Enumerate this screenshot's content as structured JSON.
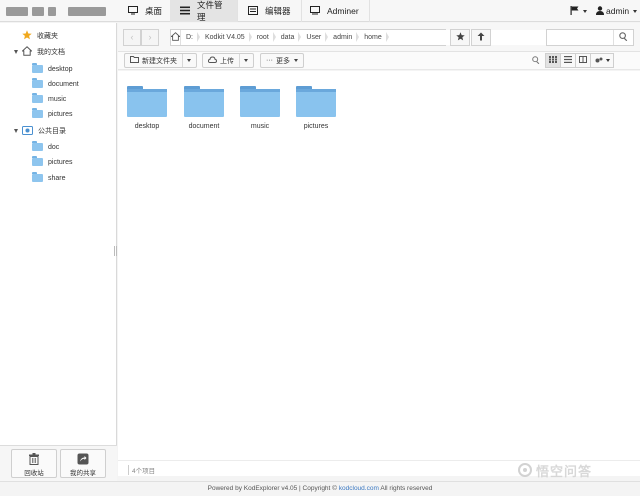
{
  "topbar": {
    "nav": [
      {
        "label": "桌面",
        "icon": "desktop-icon"
      },
      {
        "label": "文件管理",
        "icon": "list-icon",
        "active": true
      },
      {
        "label": "编辑器",
        "icon": "editor-icon"
      },
      {
        "label": "Adminer",
        "icon": "monitor-icon"
      }
    ],
    "user": "admin"
  },
  "sidebar": {
    "favorites_label": "收藏夹",
    "my_docs_label": "我的文档",
    "my_docs_children": [
      "desktop",
      "document",
      "music",
      "pictures"
    ],
    "public_label": "公共目录",
    "public_children": [
      "doc",
      "pictures",
      "share"
    ],
    "recycle_label": "回收站",
    "share_label": "我的共享"
  },
  "pathbar": {
    "crumbs": [
      "D:",
      "Kodkit V4.05",
      "root",
      "data",
      "User",
      "admin",
      "home"
    ]
  },
  "toolbar": {
    "new_folder_label": "新建文件夹",
    "upload_label": "上传",
    "more_label": "更多"
  },
  "files": [
    {
      "name": "desktop"
    },
    {
      "name": "document"
    },
    {
      "name": "music"
    },
    {
      "name": "pictures"
    }
  ],
  "status": {
    "count_text": "4个项目"
  },
  "footer": {
    "prefix": "Powered by KodExplorer v4.05 | Copyright ©",
    "link": "kodcloud.com",
    "suffix": "All rights reserved"
  },
  "watermark": {
    "text": "悟空问答"
  },
  "colors": {
    "folder": "#89c3ee",
    "folder_tab": "#5e9dd4",
    "link": "#3a78c2",
    "star": "#f0a81d"
  }
}
